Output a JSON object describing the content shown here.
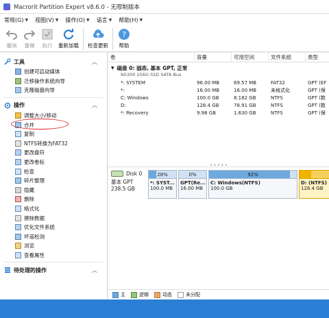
{
  "window": {
    "title": "Macrorit Partition Expert v8.6.0 - 无限制版本"
  },
  "menu": [
    {
      "label": "常规(G)"
    },
    {
      "label": "视图(V)"
    },
    {
      "label": "操作(O)"
    },
    {
      "label": "语言"
    },
    {
      "label": "帮助(H)"
    }
  ],
  "toolbar": {
    "undo": "撤消",
    "redo": "重做",
    "execute": "执行",
    "reload": "重新加载",
    "check_update": "检查更新",
    "help": "帮助"
  },
  "sidebar": {
    "tools_header": "工具",
    "tools": [
      {
        "label": "创建可启动媒体"
      },
      {
        "label": "迁移操作系统向导"
      },
      {
        "label": "克隆磁盘向导"
      }
    ],
    "ops_header": "操作",
    "ops": [
      {
        "label": "调整大小/移动"
      },
      {
        "label": "合并"
      },
      {
        "label": "复制"
      },
      {
        "label": "NTFS转换为FAT32"
      },
      {
        "label": "更改盘符"
      },
      {
        "label": "更改卷标"
      },
      {
        "label": "检查"
      },
      {
        "label": "碎片整理"
      },
      {
        "label": "隐藏"
      },
      {
        "label": "删除"
      },
      {
        "label": "格式化"
      },
      {
        "label": "擦除数据"
      },
      {
        "label": "优化文件系统"
      },
      {
        "label": "坏道检测"
      },
      {
        "label": "浏览"
      },
      {
        "label": "查看属性"
      }
    ],
    "pending_header": "待处理的操作"
  },
  "table": {
    "headers": [
      "卷",
      "容量",
      "可用空间",
      "文件系统",
      "类型"
    ],
    "disk_title": "磁盘 0: 固态, 基本 GPT, 正常",
    "disk_model": "NS300 256G SSD SATA Bus",
    "rows": [
      {
        "volume": "*: SYSTEM",
        "capacity": "96.00 MB",
        "free": "69.57 MB",
        "fs": "FAT32",
        "type": "GPT (EF"
      },
      {
        "volume": "*:",
        "capacity": "16.00 MB",
        "free": "16.00 MB",
        "fs": "未格式化",
        "type": "GPT (保"
      },
      {
        "volume": "C: Windows",
        "capacity": "100.0 GB",
        "free": "8.182 GB",
        "fs": "NTFS",
        "type": "GPT (数"
      },
      {
        "volume": "D:",
        "capacity": "128.4 GB",
        "free": "78.91 GB",
        "fs": "NTFS",
        "type": "GPT (数"
      },
      {
        "volume": "*: Recovery",
        "capacity": "9.98 GB",
        "free": "1.630 GB",
        "fs": "NTFS",
        "type": "GPT (保"
      }
    ]
  },
  "diskmap": {
    "disk_name": "Disk 0",
    "disk_type": "基本 GPT",
    "disk_size": "238.5 GB",
    "partitions": [
      {
        "pct": "28%",
        "fill": 0.28,
        "name": "*: SYST...",
        "size": "100.0 MB"
      },
      {
        "pct": "0%",
        "fill": 0.0,
        "name": "GPT(Re...",
        "size": "16.00 MB"
      },
      {
        "pct": "92%",
        "fill": 0.92,
        "name": "C: Windows(NTFS)",
        "size": "100.0 GB"
      },
      {
        "pct": "",
        "fill": 0.39,
        "name": "D: (NTFS)",
        "size": "128.4 GB"
      }
    ]
  },
  "legend": [
    "主",
    "逻辑",
    "动态",
    "未分配"
  ],
  "colors": {
    "accent": "#2a7fd4",
    "selected": "#f0b400",
    "annotation": "#d8232a"
  }
}
